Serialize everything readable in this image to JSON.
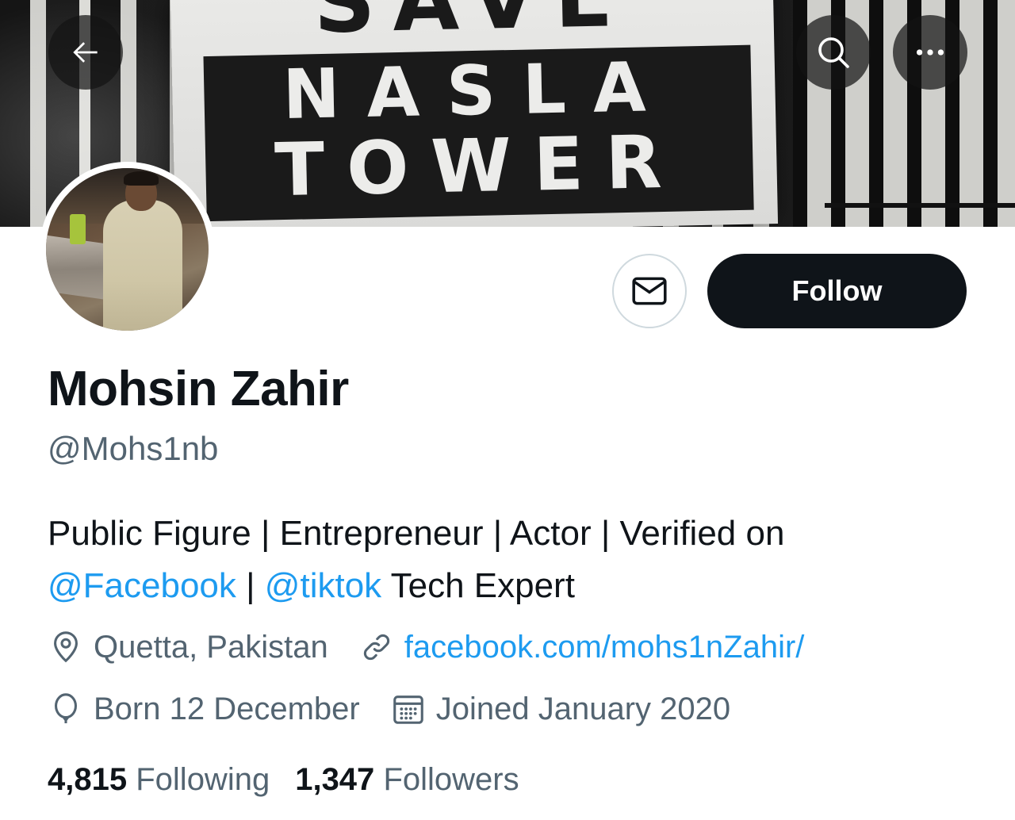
{
  "header": {
    "banner_text_line1": "SAVE",
    "banner_text_line2": "NASLA",
    "banner_text_line3": "TOWER",
    "back_icon": "arrow-left-icon",
    "search_icon": "search-icon",
    "more_icon": "more-horizontal-icon"
  },
  "profile": {
    "name": "Mohsin Zahir",
    "handle": "@Mohs1nb",
    "bio": {
      "part1": "Public Figure | Entrepreneur | Actor | Verified on ",
      "mention1": "@Facebook",
      "part2": " | ",
      "mention2": "@tiktok",
      "part3": " Tech Expert"
    },
    "location": "Quetta, Pakistan",
    "website": "facebook.com/mohs1nZahir/",
    "birthday": "Born 12 December",
    "joined": "Joined January 2020"
  },
  "actions": {
    "message_icon": "envelope-icon",
    "follow_label": "Follow"
  },
  "stats": {
    "following_count": "4,815",
    "following_label": "Following",
    "followers_count": "1,347",
    "followers_label": "Followers"
  },
  "colors": {
    "accent": "#1d9bf0",
    "text_primary": "#0f1419",
    "text_secondary": "#536471",
    "button_dark": "#0f1419",
    "border": "#cfd9de"
  }
}
